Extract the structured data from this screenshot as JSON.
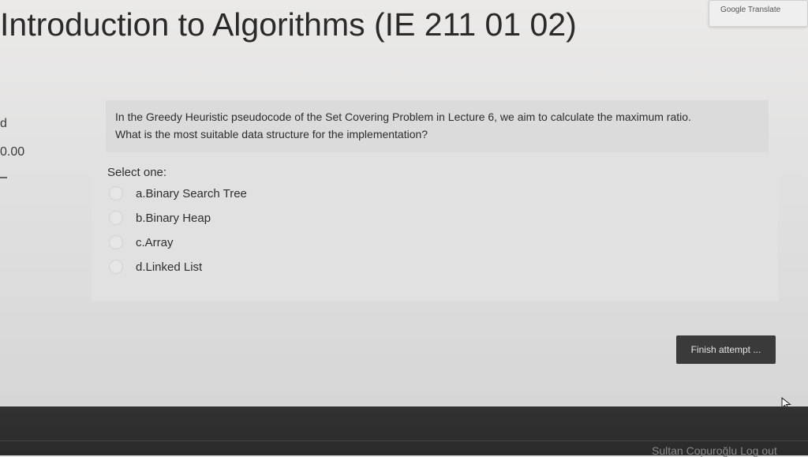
{
  "page": {
    "title": "Introduction to Algorithms (IE 211 01 02)"
  },
  "translate_widget": {
    "label": "Google Translate"
  },
  "question_info": {
    "status_fragment": "d",
    "marks_fragment": "0.00"
  },
  "question": {
    "text_line_1": "In the Greedy Heuristic pseudocode of the Set Covering Problem in Lecture 6, we aim to calculate the maximum ratio.",
    "text_line_2": "What is the most suitable data structure for the implementation?",
    "prompt": "Select one:",
    "options": [
      {
        "label": "a.Binary Search Tree"
      },
      {
        "label": "b.Binary Heap"
      },
      {
        "label": "c.Array"
      },
      {
        "label": "d.Linked List"
      }
    ]
  },
  "actions": {
    "finish_label": "Finish attempt ..."
  },
  "footer": {
    "user_text": "Sultan Copuroğlu  Log out"
  },
  "colors": {
    "page_bg": "#e6e5e5",
    "question_text_bg": "#dbdbdb",
    "answer_bg": "#e1e1e1",
    "button_bg": "#3a3a3a",
    "footer_bg": "#2f2f2f"
  }
}
